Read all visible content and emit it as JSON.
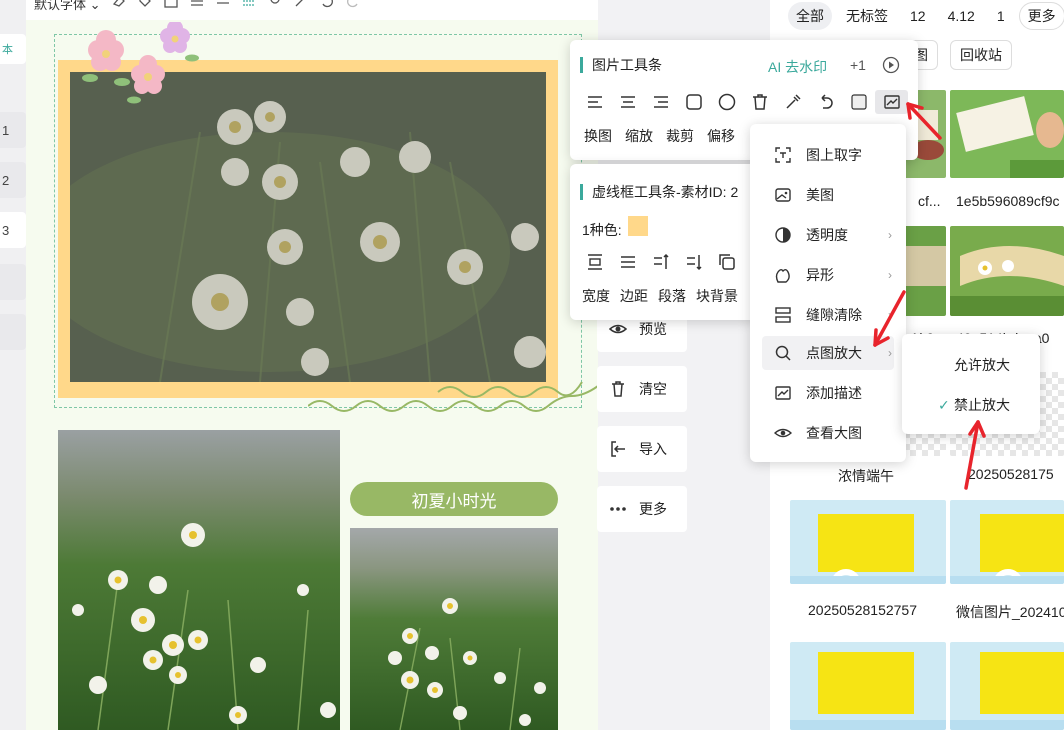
{
  "editor_toolbar": {
    "font": "默认字体 ⌄"
  },
  "left_strip": {
    "tabs": [
      "本",
      "1",
      "2",
      "3"
    ]
  },
  "canvas": {
    "caption": "初夏小时光"
  },
  "side_actions": [
    {
      "label": "预览",
      "icon": "eye-icon"
    },
    {
      "label": "清空",
      "icon": "trash-icon"
    },
    {
      "label": "导入",
      "icon": "import-icon"
    },
    {
      "label": "更多",
      "icon": "more-icon"
    }
  ],
  "right_panel": {
    "filters": [
      "全部",
      "无标签",
      "12",
      "4.12",
      "1",
      "更多"
    ],
    "tool_chips": [
      "\u0004传图",
      "回收站"
    ],
    "thumb_labels": [
      "cf...",
      "1e5b596089cf9c",
      "Ak0",
      "49e514bdaea0",
      "浓情端午",
      "20250528175",
      "20250528152757",
      "微信图片_202410"
    ]
  },
  "image_toolbar": {
    "title": "图片工具条",
    "ai_label": "AI 去水印",
    "plus": "+1",
    "labels": [
      "换图",
      "缩放",
      "裁剪",
      "偏移"
    ]
  },
  "frame_toolbar": {
    "title": "虚线框工具条-素材ID: 2",
    "color_label": "1种色:",
    "color": "#ffd88a",
    "labels": [
      "宽度",
      "边距",
      "段落",
      "块背景"
    ]
  },
  "context_menu": {
    "items": [
      "图上取字",
      "美图",
      "透明度",
      "异形",
      "缝隙清除",
      "点图放大",
      "添加描述",
      "查看大图"
    ]
  },
  "submenu": {
    "items": [
      "允许放大",
      "禁止放大"
    ],
    "checked": "✓"
  },
  "colors": {
    "accent": "#3ba99c",
    "arrow": "#e8242c",
    "caption_bg": "#98b865"
  }
}
